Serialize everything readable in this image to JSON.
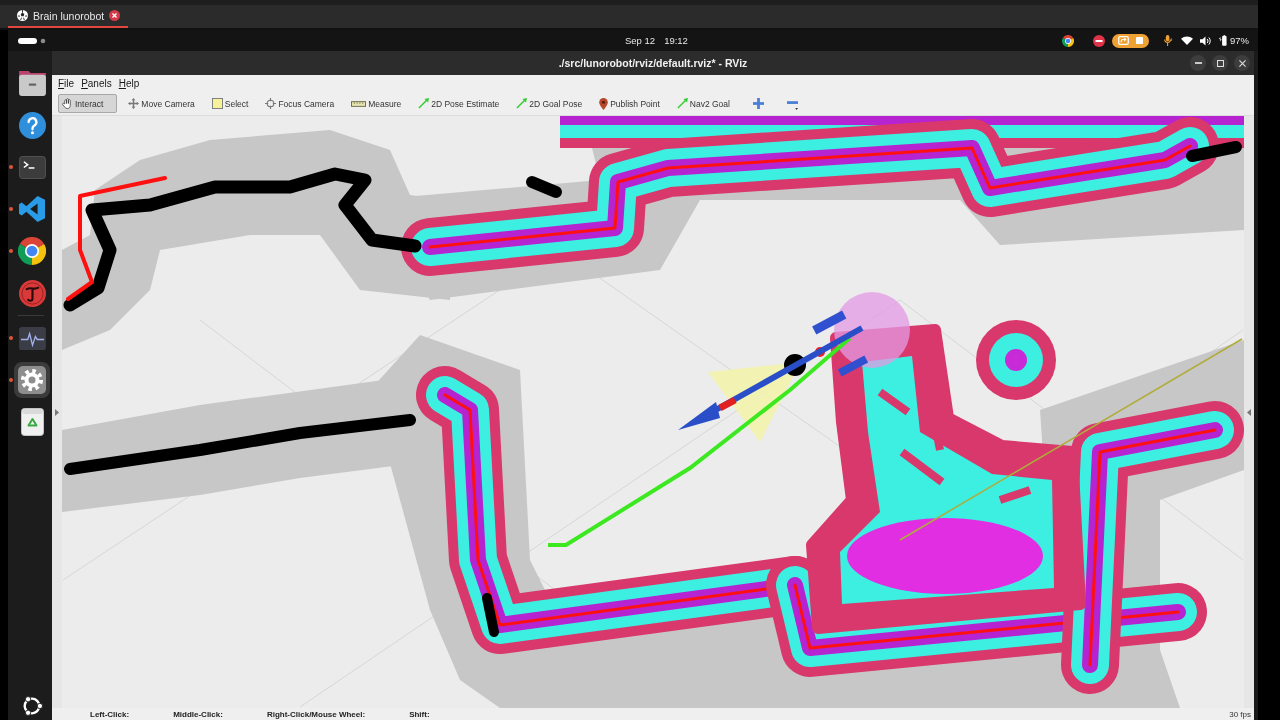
{
  "browser_tab": {
    "title": "Brain lunorobot",
    "selected": true
  },
  "top_panel": {
    "date": "Sep 12",
    "time": "19:12",
    "battery": "97%"
  },
  "dock": [
    {
      "running": false,
      "focused": false
    },
    {
      "running": false,
      "focused": false
    },
    {
      "running": true,
      "focused": false
    },
    {
      "running": true,
      "focused": false
    },
    {
      "running": true,
      "focused": false
    },
    {
      "running": false,
      "focused": false
    },
    {
      "running": true,
      "focused": false
    },
    {
      "running": true,
      "focused": true
    },
    {
      "running": false,
      "focused": false
    }
  ],
  "window": {
    "title": "./src/lunorobot/rviz/default.rviz* - RViz"
  },
  "menu": [
    "File",
    "Panels",
    "Help"
  ],
  "tools": [
    {
      "label": "Interact",
      "selected": true
    },
    {
      "label": "Move Camera",
      "selected": false
    },
    {
      "label": "Select",
      "selected": false
    },
    {
      "label": "Focus Camera",
      "selected": false
    },
    {
      "label": "Measure",
      "selected": false
    },
    {
      "label": "2D Pose Estimate",
      "selected": false
    },
    {
      "label": "2D Goal Pose",
      "selected": false
    },
    {
      "label": "Publish Point",
      "selected": false
    },
    {
      "label": "Nav2 Goal",
      "selected": false
    }
  ],
  "status_bar": {
    "hints": [
      "Left-Click:",
      "Middle-Click:",
      "Right-Click/Mouse Wheel:",
      "Shift:"
    ],
    "fps": "30 fps"
  }
}
